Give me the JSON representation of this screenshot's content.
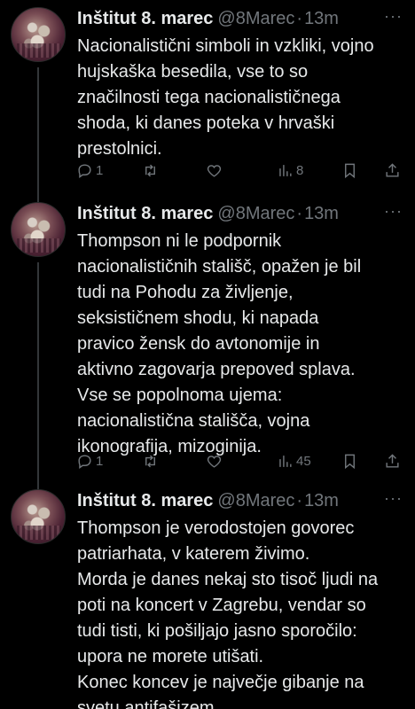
{
  "tweets": [
    {
      "name": "Inštitut 8. marec",
      "handle": "@8Marec",
      "dot": "·",
      "time": "13m",
      "more": "···",
      "text": "Nacionalistični simboli in vzkliki, vojno\nhujskaška besedila, vse to so\nznačilnosti tega nacionalističnega\nshoda, ki danes poteka v hrvaški\nprestolnici.",
      "replies": "1",
      "reposts": "",
      "likes": "",
      "views": "8"
    },
    {
      "name": "Inštitut 8. marec",
      "handle": "@8Marec",
      "dot": "·",
      "time": "13m",
      "more": "···",
      "text": "Thompson ni le podpornik\nnacionalističnih stališč, opažen je bil\ntudi na Pohodu za življenje,\nseksističnem shodu, ki napada\npravico žensk do avtonomije in\naktivno zagovarja prepoved splava.\nVse se popolnoma ujema:\nnacionalistična stališča, vojna\nikonografija, mizoginija.",
      "replies": "1",
      "reposts": "",
      "likes": "",
      "views": "45"
    },
    {
      "name": "Inštitut 8. marec",
      "handle": "@8Marec",
      "dot": "·",
      "time": "13m",
      "more": "···",
      "text": "Thompson je verodostojen govorec\npatriarhata, v katerem živimo.\nMorda je danes nekaj sto tisoč ljudi na\npoti na koncert v Zagrebu, vendar so\ntudi tisti, ki pošiljajo jasno sporočilo:\nupora ne morete utišati.\nKonec koncev je največje gibanje na\nsvetu antifašizem."
    }
  ],
  "icons": {
    "reply": "reply-icon",
    "repost": "repost-icon",
    "like": "heart-icon",
    "views": "views-icon",
    "bookmark": "bookmark-icon",
    "share": "share-icon"
  },
  "colors": {
    "background": "#000000",
    "text": "#e7e9ea",
    "muted": "#71767b",
    "thread_line": "#333639"
  }
}
